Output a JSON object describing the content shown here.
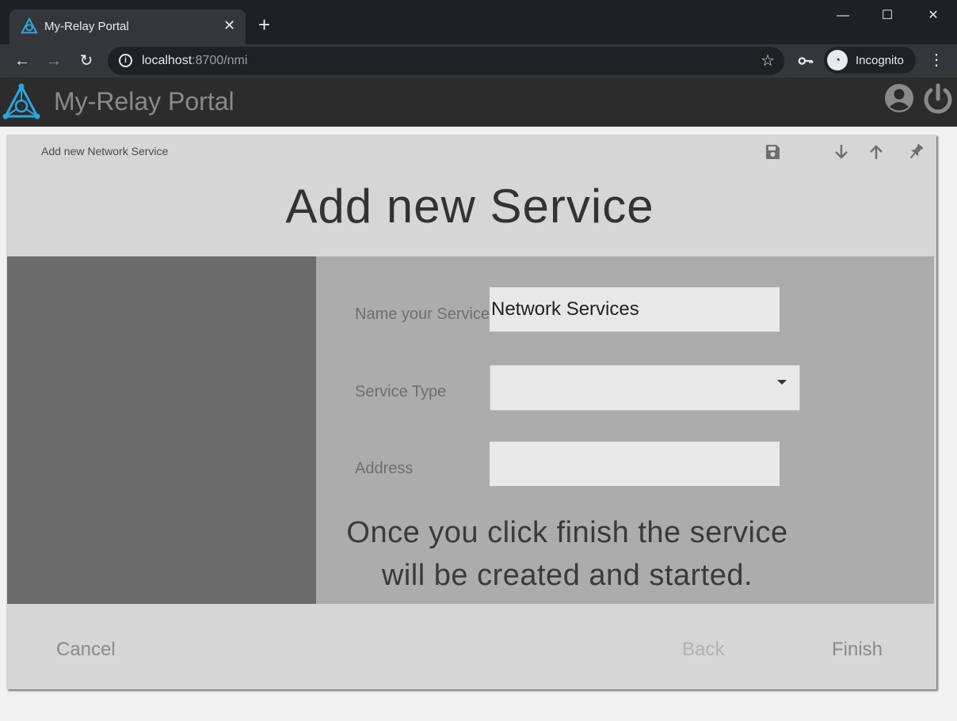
{
  "browser": {
    "tab_title": "My-Relay Portal",
    "url_host": "localhost",
    "url_path": ":8700/nmi",
    "incognito_label": "Incognito"
  },
  "app": {
    "title": "My-Relay Portal",
    "accent_color": "#29a8e0"
  },
  "dialog": {
    "breadcrumb": "Add new Network Service",
    "title": "Add new Service",
    "fields": {
      "name": {
        "label": "Name your Service",
        "value": "Network Services"
      },
      "type": {
        "label": "Service Type",
        "value": ""
      },
      "address": {
        "label": "Address",
        "value": ""
      }
    },
    "info_line1": "Once you click finish the service",
    "info_line2": "will be created and started.",
    "buttons": {
      "cancel": "Cancel",
      "back": "Back",
      "finish": "Finish"
    }
  }
}
